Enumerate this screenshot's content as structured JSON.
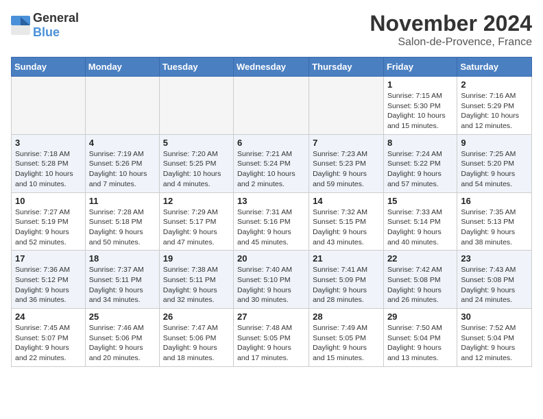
{
  "logo": {
    "general": "General",
    "blue": "Blue"
  },
  "title": "November 2024",
  "location": "Salon-de-Provence, France",
  "days_of_week": [
    "Sunday",
    "Monday",
    "Tuesday",
    "Wednesday",
    "Thursday",
    "Friday",
    "Saturday"
  ],
  "weeks": [
    [
      {
        "day": "",
        "info": ""
      },
      {
        "day": "",
        "info": ""
      },
      {
        "day": "",
        "info": ""
      },
      {
        "day": "",
        "info": ""
      },
      {
        "day": "",
        "info": ""
      },
      {
        "day": "1",
        "info": "Sunrise: 7:15 AM\nSunset: 5:30 PM\nDaylight: 10 hours and 15 minutes."
      },
      {
        "day": "2",
        "info": "Sunrise: 7:16 AM\nSunset: 5:29 PM\nDaylight: 10 hours and 12 minutes."
      }
    ],
    [
      {
        "day": "3",
        "info": "Sunrise: 7:18 AM\nSunset: 5:28 PM\nDaylight: 10 hours and 10 minutes."
      },
      {
        "day": "4",
        "info": "Sunrise: 7:19 AM\nSunset: 5:26 PM\nDaylight: 10 hours and 7 minutes."
      },
      {
        "day": "5",
        "info": "Sunrise: 7:20 AM\nSunset: 5:25 PM\nDaylight: 10 hours and 4 minutes."
      },
      {
        "day": "6",
        "info": "Sunrise: 7:21 AM\nSunset: 5:24 PM\nDaylight: 10 hours and 2 minutes."
      },
      {
        "day": "7",
        "info": "Sunrise: 7:23 AM\nSunset: 5:23 PM\nDaylight: 9 hours and 59 minutes."
      },
      {
        "day": "8",
        "info": "Sunrise: 7:24 AM\nSunset: 5:22 PM\nDaylight: 9 hours and 57 minutes."
      },
      {
        "day": "9",
        "info": "Sunrise: 7:25 AM\nSunset: 5:20 PM\nDaylight: 9 hours and 54 minutes."
      }
    ],
    [
      {
        "day": "10",
        "info": "Sunrise: 7:27 AM\nSunset: 5:19 PM\nDaylight: 9 hours and 52 minutes."
      },
      {
        "day": "11",
        "info": "Sunrise: 7:28 AM\nSunset: 5:18 PM\nDaylight: 9 hours and 50 minutes."
      },
      {
        "day": "12",
        "info": "Sunrise: 7:29 AM\nSunset: 5:17 PM\nDaylight: 9 hours and 47 minutes."
      },
      {
        "day": "13",
        "info": "Sunrise: 7:31 AM\nSunset: 5:16 PM\nDaylight: 9 hours and 45 minutes."
      },
      {
        "day": "14",
        "info": "Sunrise: 7:32 AM\nSunset: 5:15 PM\nDaylight: 9 hours and 43 minutes."
      },
      {
        "day": "15",
        "info": "Sunrise: 7:33 AM\nSunset: 5:14 PM\nDaylight: 9 hours and 40 minutes."
      },
      {
        "day": "16",
        "info": "Sunrise: 7:35 AM\nSunset: 5:13 PM\nDaylight: 9 hours and 38 minutes."
      }
    ],
    [
      {
        "day": "17",
        "info": "Sunrise: 7:36 AM\nSunset: 5:12 PM\nDaylight: 9 hours and 36 minutes."
      },
      {
        "day": "18",
        "info": "Sunrise: 7:37 AM\nSunset: 5:11 PM\nDaylight: 9 hours and 34 minutes."
      },
      {
        "day": "19",
        "info": "Sunrise: 7:38 AM\nSunset: 5:11 PM\nDaylight: 9 hours and 32 minutes."
      },
      {
        "day": "20",
        "info": "Sunrise: 7:40 AM\nSunset: 5:10 PM\nDaylight: 9 hours and 30 minutes."
      },
      {
        "day": "21",
        "info": "Sunrise: 7:41 AM\nSunset: 5:09 PM\nDaylight: 9 hours and 28 minutes."
      },
      {
        "day": "22",
        "info": "Sunrise: 7:42 AM\nSunset: 5:08 PM\nDaylight: 9 hours and 26 minutes."
      },
      {
        "day": "23",
        "info": "Sunrise: 7:43 AM\nSunset: 5:08 PM\nDaylight: 9 hours and 24 minutes."
      }
    ],
    [
      {
        "day": "24",
        "info": "Sunrise: 7:45 AM\nSunset: 5:07 PM\nDaylight: 9 hours and 22 minutes."
      },
      {
        "day": "25",
        "info": "Sunrise: 7:46 AM\nSunset: 5:06 PM\nDaylight: 9 hours and 20 minutes."
      },
      {
        "day": "26",
        "info": "Sunrise: 7:47 AM\nSunset: 5:06 PM\nDaylight: 9 hours and 18 minutes."
      },
      {
        "day": "27",
        "info": "Sunrise: 7:48 AM\nSunset: 5:05 PM\nDaylight: 9 hours and 17 minutes."
      },
      {
        "day": "28",
        "info": "Sunrise: 7:49 AM\nSunset: 5:05 PM\nDaylight: 9 hours and 15 minutes."
      },
      {
        "day": "29",
        "info": "Sunrise: 7:50 AM\nSunset: 5:04 PM\nDaylight: 9 hours and 13 minutes."
      },
      {
        "day": "30",
        "info": "Sunrise: 7:52 AM\nSunset: 5:04 PM\nDaylight: 9 hours and 12 minutes."
      }
    ]
  ]
}
